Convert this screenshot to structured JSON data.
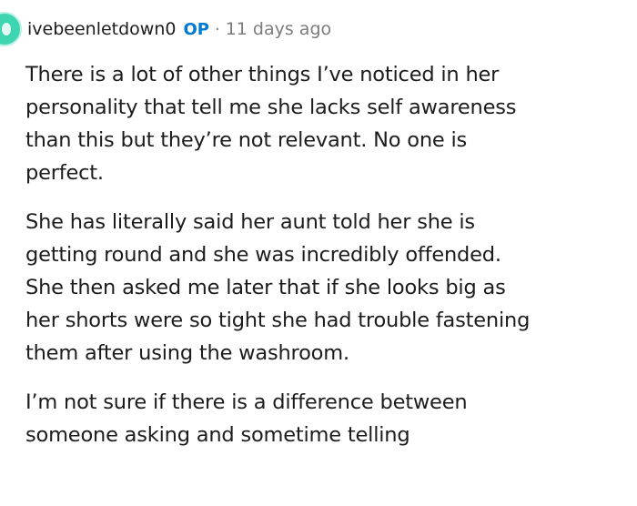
{
  "comment": {
    "username": "ivebeenletdown0",
    "badge": "OP",
    "separator": "·",
    "timestamp": "11 days ago",
    "paragraphs": [
      "There is a lot of other things I’ve noticed in her\npersonality that tell me she lacks self awareness\nthan this but they’re not relevant. No one is\nperfect.",
      "She has literally said her aunt told her she is\ngetting round and she was incredibly offended.\nShe then asked me later that if she looks big as\nher shorts were so tight she had trouble fastening\nthem after using the washroom.",
      "I’m not sure if there is a difference between\nsomeone asking and sometime telling"
    ]
  },
  "colors": {
    "accent": "#0079d3",
    "avatar": "#3ed6b1",
    "muted": "#7c7c7c",
    "text": "#1c1c1c"
  }
}
